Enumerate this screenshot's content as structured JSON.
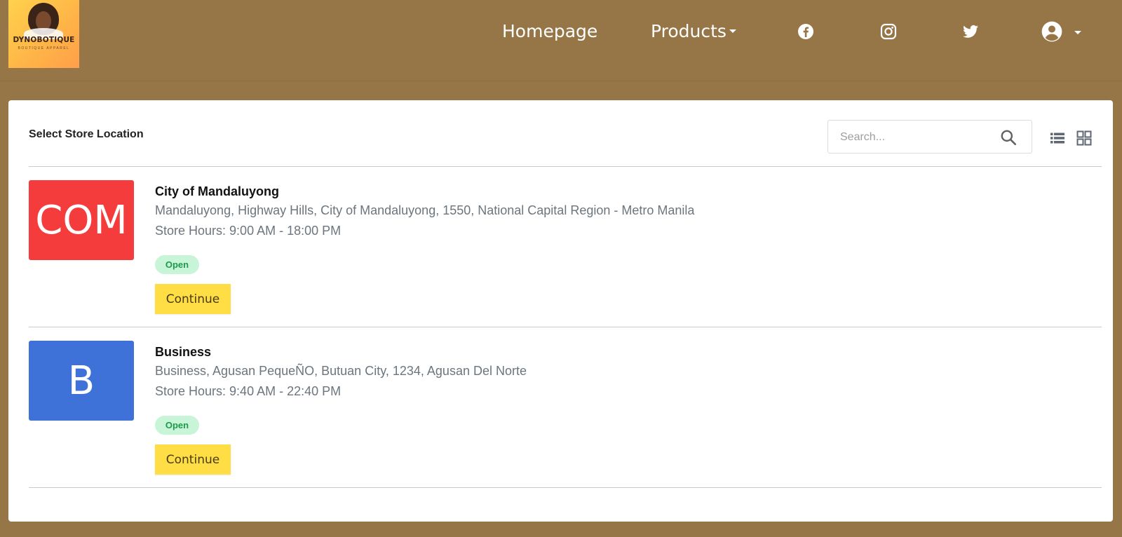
{
  "brand": {
    "name": "DYNOBOTIQUE",
    "tagline": "BOUTIQUE APPAREL"
  },
  "nav": {
    "homepage": "Homepage",
    "products": "Products",
    "icons": [
      "facebook-icon",
      "instagram-icon",
      "twitter-icon",
      "account-icon"
    ]
  },
  "colors": {
    "background": "#967547",
    "open_badge_bg": "#c8f5d8",
    "open_badge_text": "#1d9a4a",
    "continue_button": "#fede44"
  },
  "page": {
    "title": "Select Store Location",
    "search_placeholder": "Search...",
    "view_icons": [
      "list-view-icon",
      "grid-view-icon"
    ]
  },
  "stores": [
    {
      "initials": "COM",
      "color": "#f53c3c",
      "name": "City of Mandaluyong",
      "address": "Mandaluyong, Highway Hills, City of Mandaluyong, 1550, National Capital Region - Metro Manila",
      "hours": "Store Hours: 9:00 AM - 18:00 PM",
      "status": "Open",
      "button": "Continue"
    },
    {
      "initials": "B",
      "color": "#3f72d9",
      "name": "Business",
      "address": "Business, Agusan PequeÑO, Butuan City, 1234, Agusan Del Norte",
      "hours": "Store Hours: 9:40 AM - 22:40 PM",
      "status": "Open",
      "button": "Continue"
    }
  ]
}
